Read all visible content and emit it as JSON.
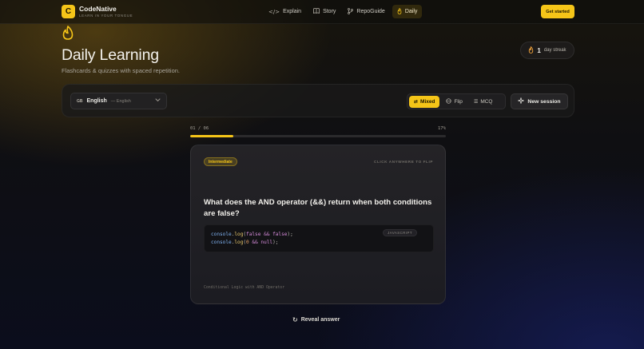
{
  "brand": {
    "logo_letter": "C",
    "name": "CodeNative",
    "tagline": "LEARN IN YOUR TONGUE",
    "accent_color": "#f5c518"
  },
  "nav": {
    "items": [
      {
        "label": "Explain",
        "icon": "code-icon",
        "active": false
      },
      {
        "label": "Story",
        "icon": "book-icon",
        "active": false
      },
      {
        "label": "RepoGuide",
        "icon": "git-branch-icon",
        "active": false
      },
      {
        "label": "Daily",
        "icon": "flame-icon",
        "active": true
      }
    ],
    "cta_label": "Get started"
  },
  "hero": {
    "icon": "flame-icon",
    "title": "Daily Learning",
    "subtitle": "Flashcards & quizzes with spaced repetition.",
    "streak_count": "1",
    "streak_label": "day streak"
  },
  "toolbar": {
    "language": {
      "code": "GB",
      "name": "English",
      "native": "— English"
    },
    "modes": [
      {
        "label": "Mixed",
        "icon": "shuffle-icon",
        "active": true
      },
      {
        "label": "Flip",
        "icon": "layers-icon",
        "active": false
      },
      {
        "label": "MCQ",
        "icon": "list-icon",
        "active": false
      }
    ],
    "new_session_label": "New session"
  },
  "progress": {
    "count_text": "01 / 06",
    "percent_text": "17%",
    "fraction": 0.17
  },
  "card": {
    "level": "Intermediate",
    "flip_hint": "CLICK ANYWHERE TO FLIP",
    "question": "What does the AND operator (&&) return when both conditions are false?",
    "code_language": "JAVASCRIPT",
    "code_lines": [
      "console.log(false && false);",
      "console.log(0 && null);"
    ],
    "topic": "Conditional Logic with AND Operator"
  },
  "reveal": {
    "label": "Reveal answer",
    "icon": "rotate-icon"
  }
}
